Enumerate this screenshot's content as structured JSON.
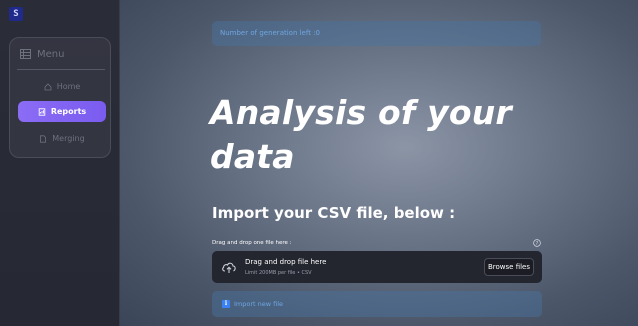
{
  "sidebar": {
    "logo_text": "S",
    "menu": {
      "title": "Menu",
      "items": [
        {
          "label": "Home",
          "icon": "home-icon",
          "active": false
        },
        {
          "label": "Reports",
          "icon": "report-icon",
          "active": true
        },
        {
          "label": "Merging",
          "icon": "document-icon",
          "active": false
        }
      ]
    }
  },
  "main": {
    "generation_banner": "Number of generation left :0",
    "title": "Analysis of your data",
    "import_heading": "Import your CSV file, below :",
    "uploader": {
      "label": "Drag and drop one file here :",
      "dropzone_title": "Drag and drop file here",
      "dropzone_subtitle": "Limit 200MB per file • CSV",
      "browse_label": "Browse files"
    },
    "import_new": {
      "icon": "info-icon",
      "label": "Import new file"
    }
  },
  "colors": {
    "accent": "#8b6cf5",
    "info_blue": "#6fa6e0",
    "dropzone_bg": "#23252f",
    "sidebar_bg": "#2a2c38"
  }
}
